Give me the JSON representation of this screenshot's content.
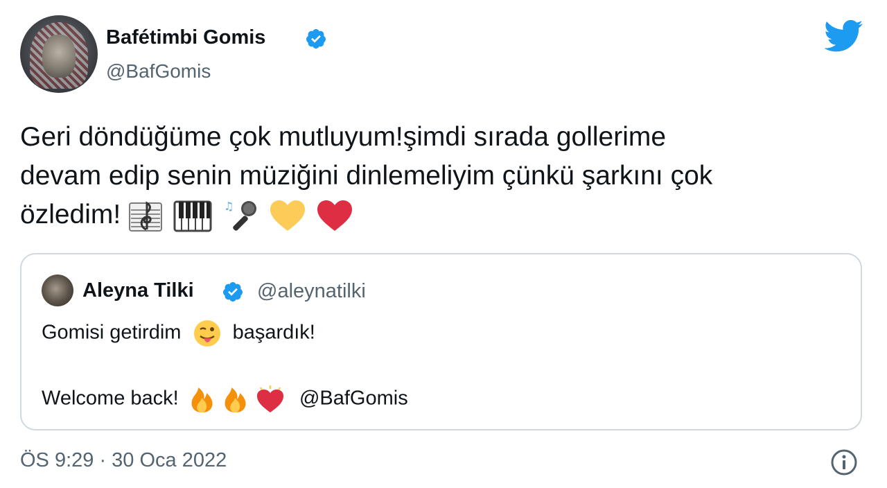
{
  "author": {
    "name": "Bafétimbi Gomis",
    "handle": "@BafGomis",
    "verified_icon": "verified-badge-icon",
    "avatar_icon": "lion-avatar"
  },
  "platform": {
    "logo_icon": "twitter-bird-icon",
    "brand_color": "#1d9bf0"
  },
  "tweet": {
    "line1": "Geri döndüğüme çok mutluyum!şimdi sırada gollerime",
    "line2": "devam edip senin müziğini dinlemeliyim çünkü şarkını çok",
    "line3": "özledim!",
    "emojis": [
      "musical-score-emoji",
      "piano-emoji",
      "microphone-emoji",
      "yellow-heart-emoji",
      "red-heart-emoji"
    ]
  },
  "quote": {
    "name": "Aleyna Tilki",
    "handle": "@aleynatilki",
    "text1_a": "Gomisi getirdim",
    "text1_b": "başardık!",
    "text2_a": "Welcome back!",
    "text2_mention": "@BafGomis",
    "emojis_line1": [
      "winking-tongue-emoji"
    ],
    "emojis_line2": [
      "fire-emoji",
      "fire-emoji",
      "growing-heart-emoji"
    ]
  },
  "timestamp": "ÖS 9:29 · 30 Oca 2022",
  "colors": {
    "text": "#0f1419",
    "muted": "#536471",
    "border": "#cfd9de",
    "verified": "#1d9bf0"
  }
}
